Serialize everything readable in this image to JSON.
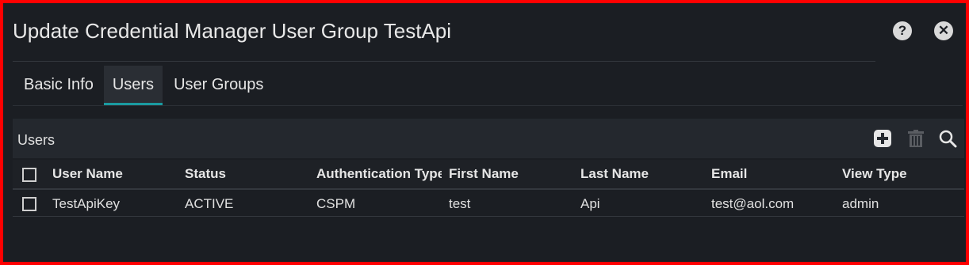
{
  "dialog": {
    "title": "Update Credential Manager User Group TestApi",
    "help_icon": "question-circle-icon",
    "help_glyph": "?",
    "close_icon": "close-circle-icon",
    "close_glyph": "✕"
  },
  "tabs": [
    {
      "label": "Basic Info",
      "active": false
    },
    {
      "label": "Users",
      "active": true
    },
    {
      "label": "User Groups",
      "active": false
    }
  ],
  "panel": {
    "title": "Users",
    "tools": [
      "plus-square-icon",
      "trash-icon",
      "search-icon"
    ]
  },
  "table": {
    "columns": [
      "User Name",
      "Status",
      "Authentication Type",
      "First Name",
      "Last Name",
      "Email",
      "View Type"
    ],
    "rows": [
      [
        "TestApiKey",
        "ACTIVE",
        "CSPM",
        "test",
        "Api",
        "test@aol.com",
        "admin"
      ]
    ]
  },
  "colors": {
    "frame_border": "#ff0000",
    "background": "#1b1e23",
    "tab_underline": "#1a9aa0"
  }
}
